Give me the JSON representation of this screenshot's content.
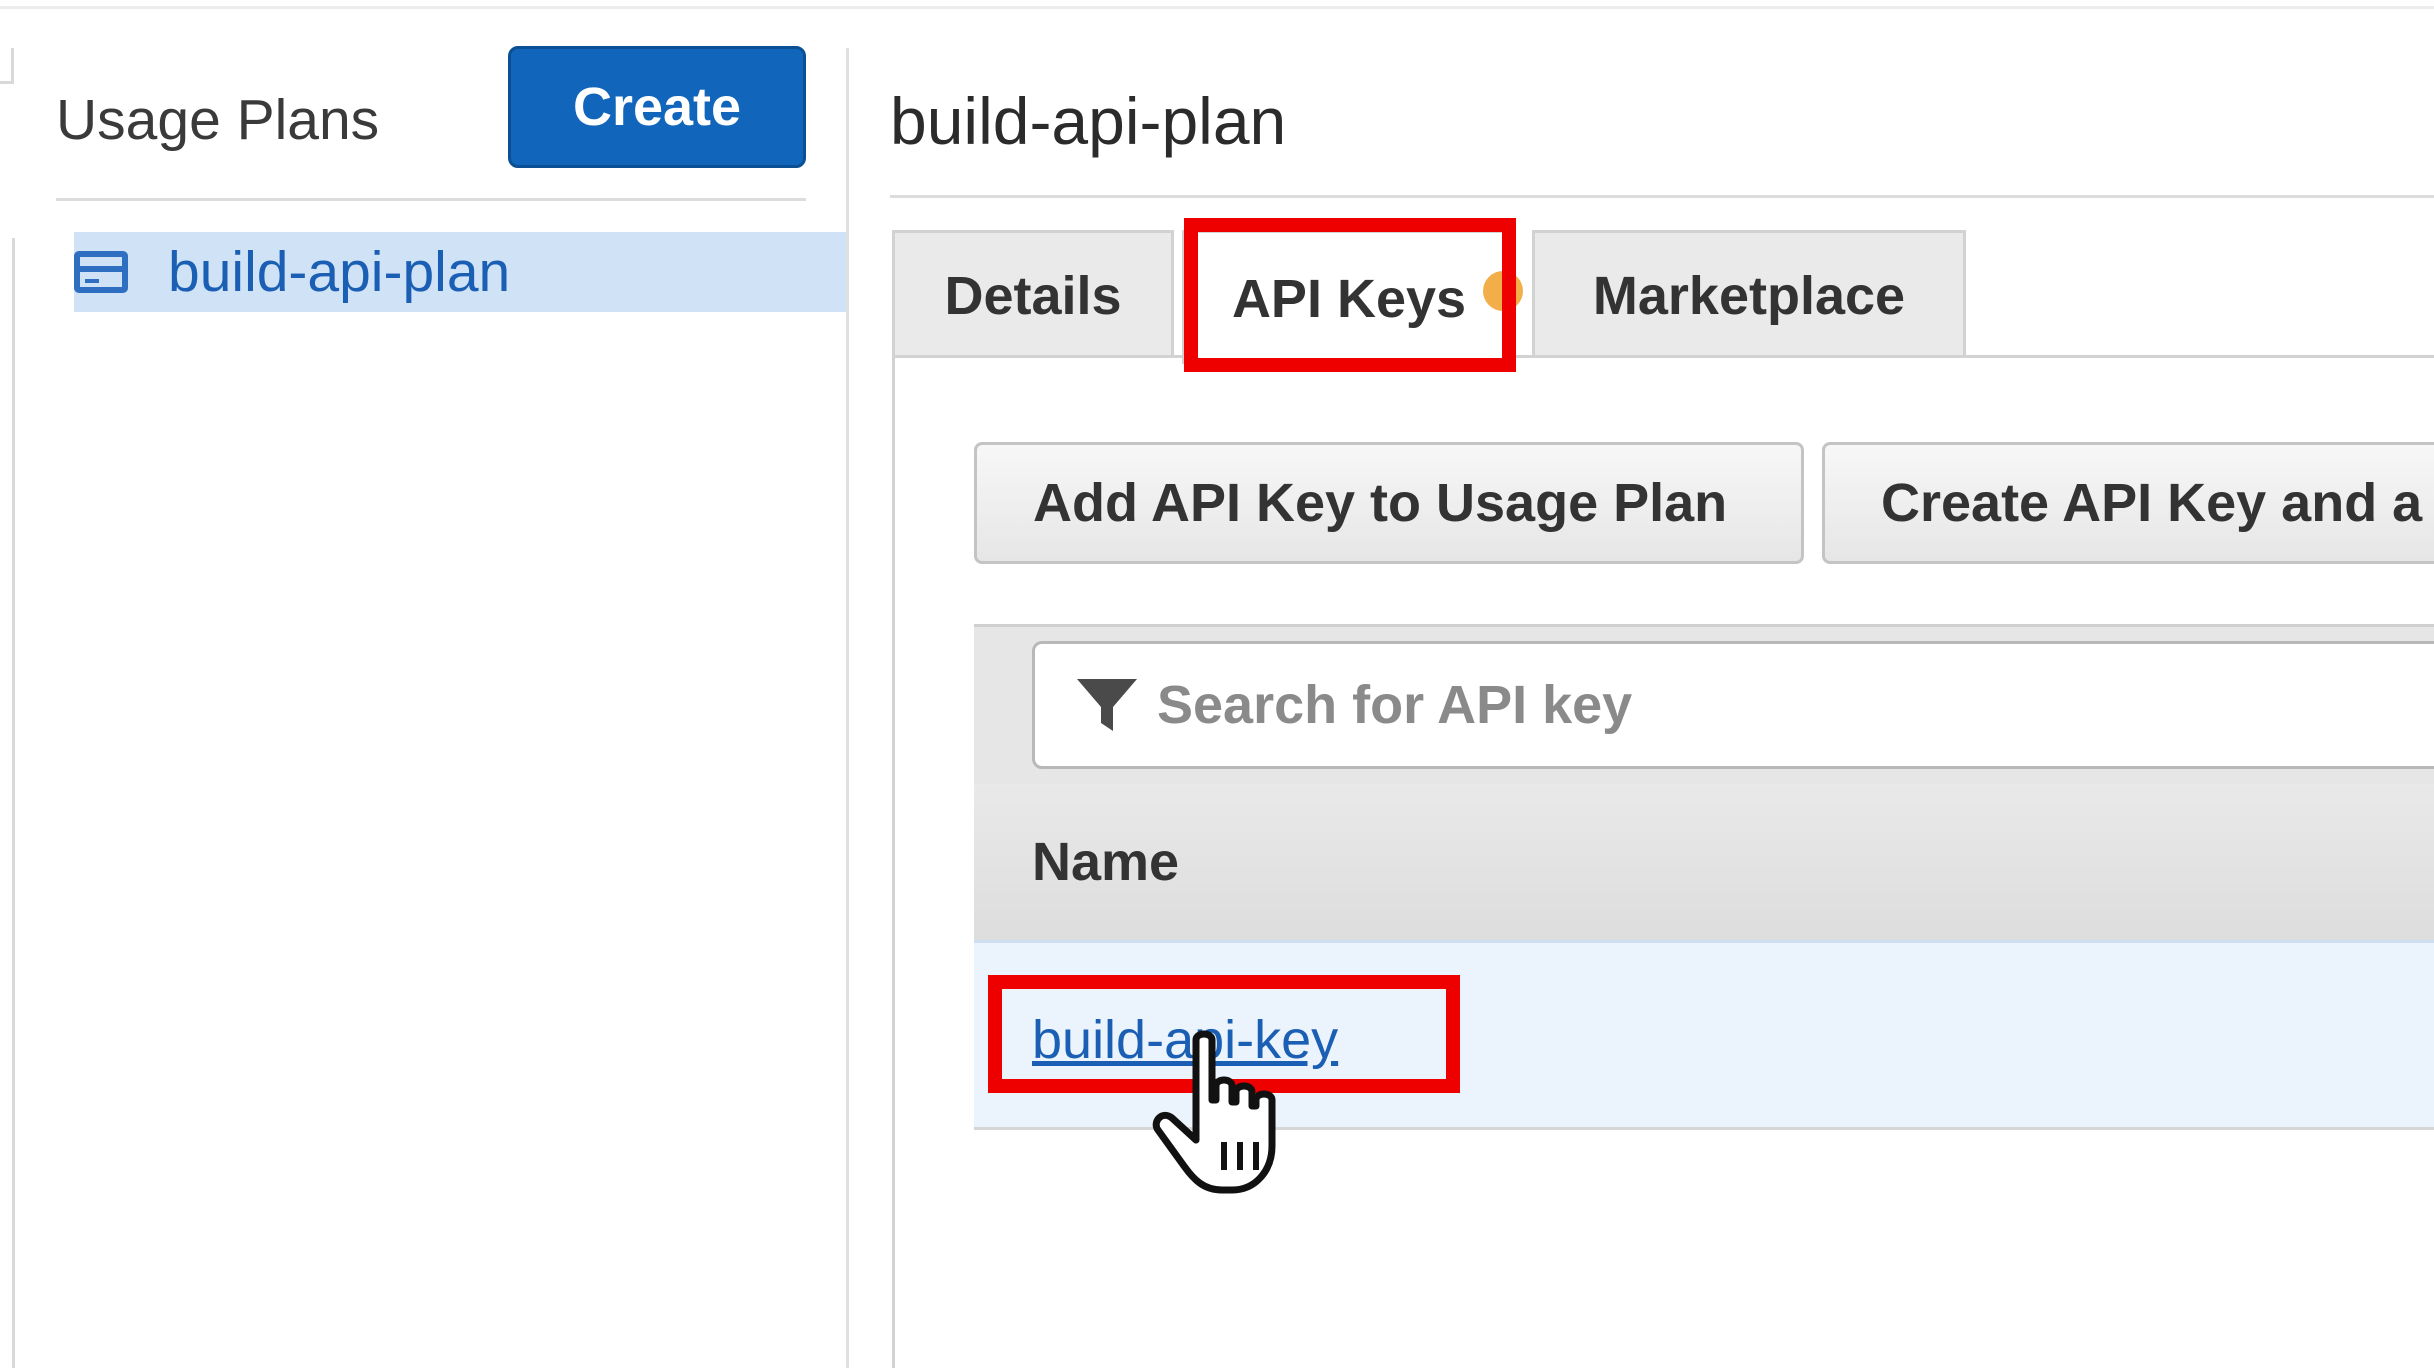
{
  "sidebar": {
    "title": "Usage Plans",
    "create_label": "Create",
    "items": [
      {
        "label": "build-api-plan",
        "icon": "usage-plan-icon",
        "selected": true
      }
    ]
  },
  "main": {
    "title": "build-api-plan",
    "tabs": [
      {
        "label": "Details",
        "active": false
      },
      {
        "label": "API Keys",
        "active": true
      },
      {
        "label": "Marketplace",
        "active": false
      }
    ],
    "actions": {
      "add_key_label": "Add API Key to Usage Plan",
      "create_key_label": "Create API Key and a"
    },
    "search": {
      "placeholder": "Search for API key",
      "icon": "filter-icon"
    },
    "table": {
      "columns": [
        "Name"
      ],
      "rows": [
        {
          "name": "build-api-key"
        }
      ]
    }
  },
  "colors": {
    "accent": "#1166bb",
    "highlight": "#ee0000",
    "link": "#1a5fb4",
    "selected_row": "#cfe2f6"
  }
}
